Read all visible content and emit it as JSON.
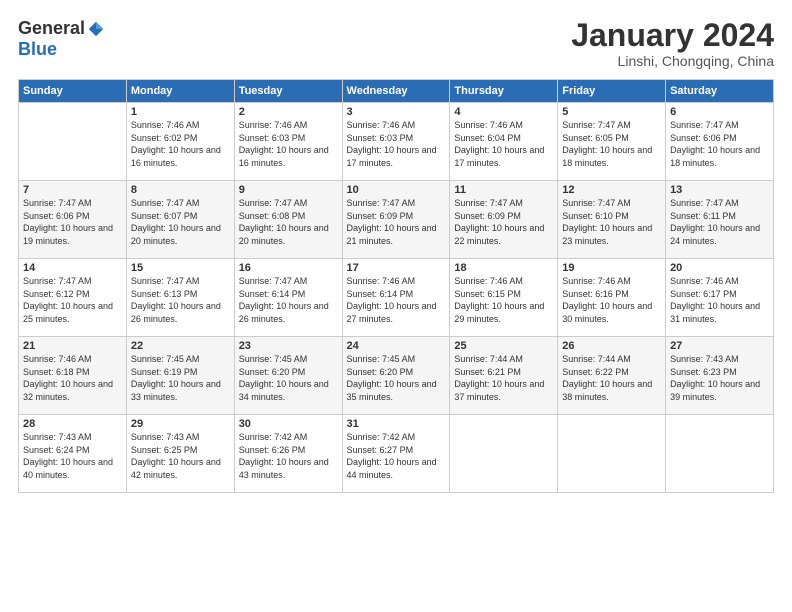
{
  "logo": {
    "general": "General",
    "blue": "Blue"
  },
  "title": "January 2024",
  "location": "Linshi, Chongqing, China",
  "days_of_week": [
    "Sunday",
    "Monday",
    "Tuesday",
    "Wednesday",
    "Thursday",
    "Friday",
    "Saturday"
  ],
  "weeks": [
    [
      {
        "day": "",
        "sunrise": "",
        "sunset": "",
        "daylight": ""
      },
      {
        "day": "1",
        "sunrise": "Sunrise: 7:46 AM",
        "sunset": "Sunset: 6:02 PM",
        "daylight": "Daylight: 10 hours and 16 minutes."
      },
      {
        "day": "2",
        "sunrise": "Sunrise: 7:46 AM",
        "sunset": "Sunset: 6:03 PM",
        "daylight": "Daylight: 10 hours and 16 minutes."
      },
      {
        "day": "3",
        "sunrise": "Sunrise: 7:46 AM",
        "sunset": "Sunset: 6:03 PM",
        "daylight": "Daylight: 10 hours and 17 minutes."
      },
      {
        "day": "4",
        "sunrise": "Sunrise: 7:46 AM",
        "sunset": "Sunset: 6:04 PM",
        "daylight": "Daylight: 10 hours and 17 minutes."
      },
      {
        "day": "5",
        "sunrise": "Sunrise: 7:47 AM",
        "sunset": "Sunset: 6:05 PM",
        "daylight": "Daylight: 10 hours and 18 minutes."
      },
      {
        "day": "6",
        "sunrise": "Sunrise: 7:47 AM",
        "sunset": "Sunset: 6:06 PM",
        "daylight": "Daylight: 10 hours and 18 minutes."
      }
    ],
    [
      {
        "day": "7",
        "sunrise": "Sunrise: 7:47 AM",
        "sunset": "Sunset: 6:06 PM",
        "daylight": "Daylight: 10 hours and 19 minutes."
      },
      {
        "day": "8",
        "sunrise": "Sunrise: 7:47 AM",
        "sunset": "Sunset: 6:07 PM",
        "daylight": "Daylight: 10 hours and 20 minutes."
      },
      {
        "day": "9",
        "sunrise": "Sunrise: 7:47 AM",
        "sunset": "Sunset: 6:08 PM",
        "daylight": "Daylight: 10 hours and 20 minutes."
      },
      {
        "day": "10",
        "sunrise": "Sunrise: 7:47 AM",
        "sunset": "Sunset: 6:09 PM",
        "daylight": "Daylight: 10 hours and 21 minutes."
      },
      {
        "day": "11",
        "sunrise": "Sunrise: 7:47 AM",
        "sunset": "Sunset: 6:09 PM",
        "daylight": "Daylight: 10 hours and 22 minutes."
      },
      {
        "day": "12",
        "sunrise": "Sunrise: 7:47 AM",
        "sunset": "Sunset: 6:10 PM",
        "daylight": "Daylight: 10 hours and 23 minutes."
      },
      {
        "day": "13",
        "sunrise": "Sunrise: 7:47 AM",
        "sunset": "Sunset: 6:11 PM",
        "daylight": "Daylight: 10 hours and 24 minutes."
      }
    ],
    [
      {
        "day": "14",
        "sunrise": "Sunrise: 7:47 AM",
        "sunset": "Sunset: 6:12 PM",
        "daylight": "Daylight: 10 hours and 25 minutes."
      },
      {
        "day": "15",
        "sunrise": "Sunrise: 7:47 AM",
        "sunset": "Sunset: 6:13 PM",
        "daylight": "Daylight: 10 hours and 26 minutes."
      },
      {
        "day": "16",
        "sunrise": "Sunrise: 7:47 AM",
        "sunset": "Sunset: 6:14 PM",
        "daylight": "Daylight: 10 hours and 26 minutes."
      },
      {
        "day": "17",
        "sunrise": "Sunrise: 7:46 AM",
        "sunset": "Sunset: 6:14 PM",
        "daylight": "Daylight: 10 hours and 27 minutes."
      },
      {
        "day": "18",
        "sunrise": "Sunrise: 7:46 AM",
        "sunset": "Sunset: 6:15 PM",
        "daylight": "Daylight: 10 hours and 29 minutes."
      },
      {
        "day": "19",
        "sunrise": "Sunrise: 7:46 AM",
        "sunset": "Sunset: 6:16 PM",
        "daylight": "Daylight: 10 hours and 30 minutes."
      },
      {
        "day": "20",
        "sunrise": "Sunrise: 7:46 AM",
        "sunset": "Sunset: 6:17 PM",
        "daylight": "Daylight: 10 hours and 31 minutes."
      }
    ],
    [
      {
        "day": "21",
        "sunrise": "Sunrise: 7:46 AM",
        "sunset": "Sunset: 6:18 PM",
        "daylight": "Daylight: 10 hours and 32 minutes."
      },
      {
        "day": "22",
        "sunrise": "Sunrise: 7:45 AM",
        "sunset": "Sunset: 6:19 PM",
        "daylight": "Daylight: 10 hours and 33 minutes."
      },
      {
        "day": "23",
        "sunrise": "Sunrise: 7:45 AM",
        "sunset": "Sunset: 6:20 PM",
        "daylight": "Daylight: 10 hours and 34 minutes."
      },
      {
        "day": "24",
        "sunrise": "Sunrise: 7:45 AM",
        "sunset": "Sunset: 6:20 PM",
        "daylight": "Daylight: 10 hours and 35 minutes."
      },
      {
        "day": "25",
        "sunrise": "Sunrise: 7:44 AM",
        "sunset": "Sunset: 6:21 PM",
        "daylight": "Daylight: 10 hours and 37 minutes."
      },
      {
        "day": "26",
        "sunrise": "Sunrise: 7:44 AM",
        "sunset": "Sunset: 6:22 PM",
        "daylight": "Daylight: 10 hours and 38 minutes."
      },
      {
        "day": "27",
        "sunrise": "Sunrise: 7:43 AM",
        "sunset": "Sunset: 6:23 PM",
        "daylight": "Daylight: 10 hours and 39 minutes."
      }
    ],
    [
      {
        "day": "28",
        "sunrise": "Sunrise: 7:43 AM",
        "sunset": "Sunset: 6:24 PM",
        "daylight": "Daylight: 10 hours and 40 minutes."
      },
      {
        "day": "29",
        "sunrise": "Sunrise: 7:43 AM",
        "sunset": "Sunset: 6:25 PM",
        "daylight": "Daylight: 10 hours and 42 minutes."
      },
      {
        "day": "30",
        "sunrise": "Sunrise: 7:42 AM",
        "sunset": "Sunset: 6:26 PM",
        "daylight": "Daylight: 10 hours and 43 minutes."
      },
      {
        "day": "31",
        "sunrise": "Sunrise: 7:42 AM",
        "sunset": "Sunset: 6:27 PM",
        "daylight": "Daylight: 10 hours and 44 minutes."
      },
      {
        "day": "",
        "sunrise": "",
        "sunset": "",
        "daylight": ""
      },
      {
        "day": "",
        "sunrise": "",
        "sunset": "",
        "daylight": ""
      },
      {
        "day": "",
        "sunrise": "",
        "sunset": "",
        "daylight": ""
      }
    ]
  ]
}
